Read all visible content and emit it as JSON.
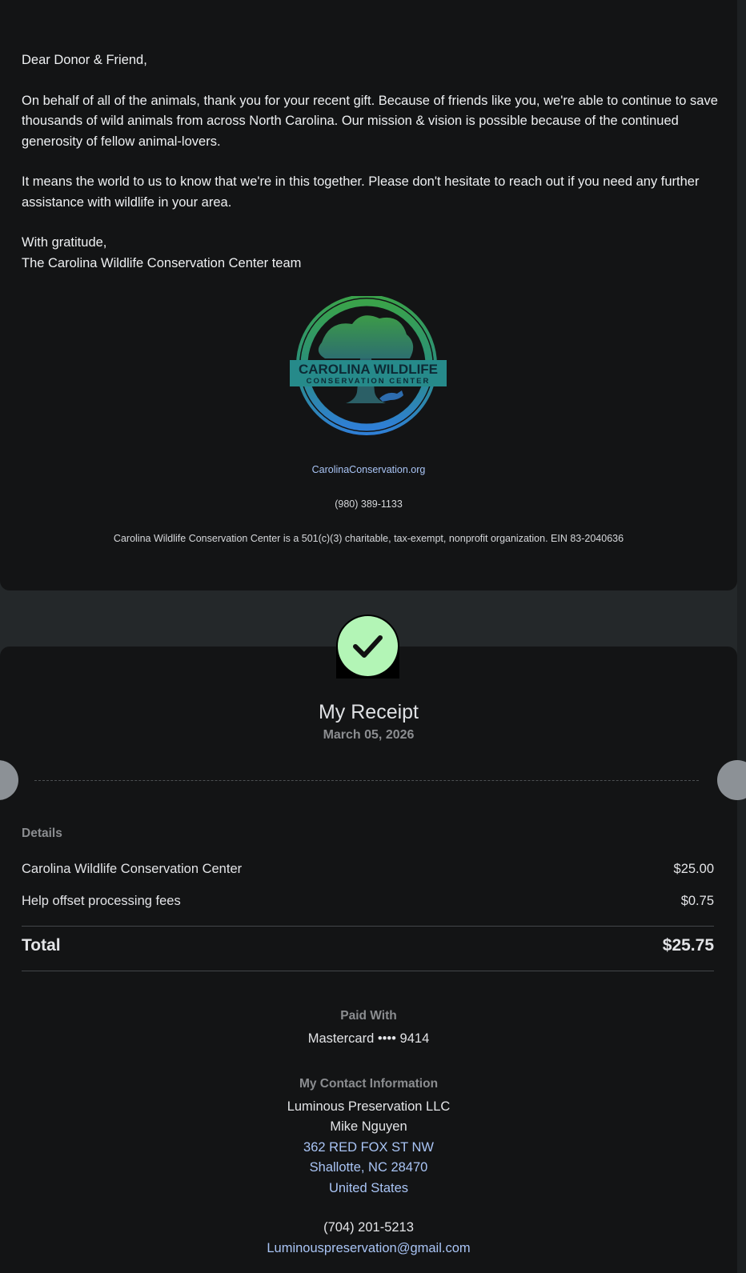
{
  "letter": {
    "greeting": "Dear Donor & Friend,",
    "para1": "On behalf of all of the animals, thank you for your recent gift. Because of friends like you, we're able to continue to save thousands of wild animals from across North Carolina. Our mission & vision is possible because of the continued generosity of fellow animal-lovers.",
    "para2": "It means the world to us to know that we're in this together. Please don't hesitate to reach out if you need any further assistance with wildlife in your area.",
    "closing": "With gratitude,",
    "signature": "The Carolina Wildlife Conservation Center team"
  },
  "logo": {
    "line1": "CAROLINA WILDLIFE",
    "line2": "CONSERVATION CENTER",
    "icon": "tree-fox-logo"
  },
  "org_footer": {
    "website": "CarolinaConservation.org",
    "phone": "(980) 389-1133",
    "legal": "Carolina Wildlife Conservation Center is a 501(c)(3) charitable, tax-exempt, nonprofit organization. EIN 83-2040636"
  },
  "receipt": {
    "status_icon": "checkmark-icon",
    "title": "My Receipt",
    "date": "March 05, 2026",
    "details_label": "Details",
    "items": [
      {
        "label": "Carolina Wildlife Conservation Center",
        "amount": "$25.00"
      },
      {
        "label": "Help offset processing fees",
        "amount": "$0.75"
      }
    ],
    "total_label": "Total",
    "total_amount": "$25.75",
    "paid_with_label": "Paid With",
    "paid_with_value": "Mastercard •••• 9414",
    "contact_label": "My Contact Information",
    "contact": {
      "company": "Luminous Preservation LLC",
      "name": "Mike Nguyen",
      "street": "362 RED FOX ST NW",
      "city_line": "Shallotte, NC 28470",
      "country": "United States",
      "phone": "(704) 201-5213",
      "email": "Luminouspreservation@gmail.com"
    }
  },
  "colors": {
    "background": "#24282a",
    "card": "#131415",
    "accent_green": "#b3f5b6",
    "link_blue": "#a9c4f5"
  }
}
